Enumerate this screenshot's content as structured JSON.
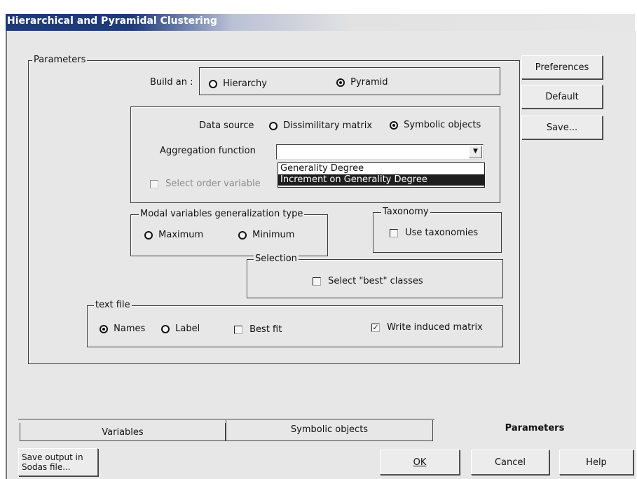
{
  "window": {
    "title": "Hierarchical and Pyramidal Clustering"
  },
  "side_buttons": {
    "preferences": "Preferences",
    "default": "Default",
    "save": "Save..."
  },
  "parameters_group": {
    "legend": "Parameters",
    "build_an": {
      "label": "Build an :",
      "options": [
        {
          "label": "Hierarchy",
          "selected": false
        },
        {
          "label": "Pyramid",
          "selected": true
        }
      ]
    },
    "data_source": {
      "label": "Data source",
      "options": [
        {
          "label": "Dissimilitary matrix",
          "selected": false
        },
        {
          "label": "Symbolic objects",
          "selected": true
        }
      ]
    },
    "aggregation": {
      "label": "Aggregation function",
      "value": "",
      "options": [
        {
          "label": "Generality Degree",
          "highlighted": false
        },
        {
          "label": "Increment on Generality Degree",
          "highlighted": true
        }
      ]
    },
    "select_order_variable": {
      "label": "Select order variable",
      "checked": false,
      "enabled": false
    },
    "modal": {
      "legend": "Modal variables generalization type",
      "options": [
        {
          "label": "Maximum",
          "selected": false
        },
        {
          "label": "Minimum",
          "selected": false
        }
      ]
    },
    "taxonomy": {
      "legend": "Taxonomy",
      "use_taxonomies": {
        "label": "Use taxonomies",
        "checked": false
      }
    },
    "selection": {
      "legend": "Selection",
      "select_best": {
        "label": "Select \"best\" classes",
        "checked": false
      }
    },
    "text_file": {
      "legend": "text file",
      "names": {
        "label": "Names",
        "selected": true
      },
      "label_opt": {
        "label": "Label",
        "selected": false
      },
      "best_fit": {
        "label": "Best fit",
        "checked": false
      },
      "write_induced": {
        "label": "Write induced matrix",
        "checked": true
      }
    }
  },
  "tabs": [
    {
      "label": "Variables",
      "active": false
    },
    {
      "label": "Symbolic objects",
      "active": false
    },
    {
      "label": "Parameters",
      "active": true
    }
  ],
  "bottom": {
    "save_output_line1": "Save output in",
    "save_output_line2": "Sodas file...",
    "ok": "OK",
    "cancel": "Cancel",
    "help": "Help"
  },
  "colors": {
    "title_bar": "#1f3a78",
    "face": "#e7e7e7",
    "highlight": "#1e1e1e"
  }
}
